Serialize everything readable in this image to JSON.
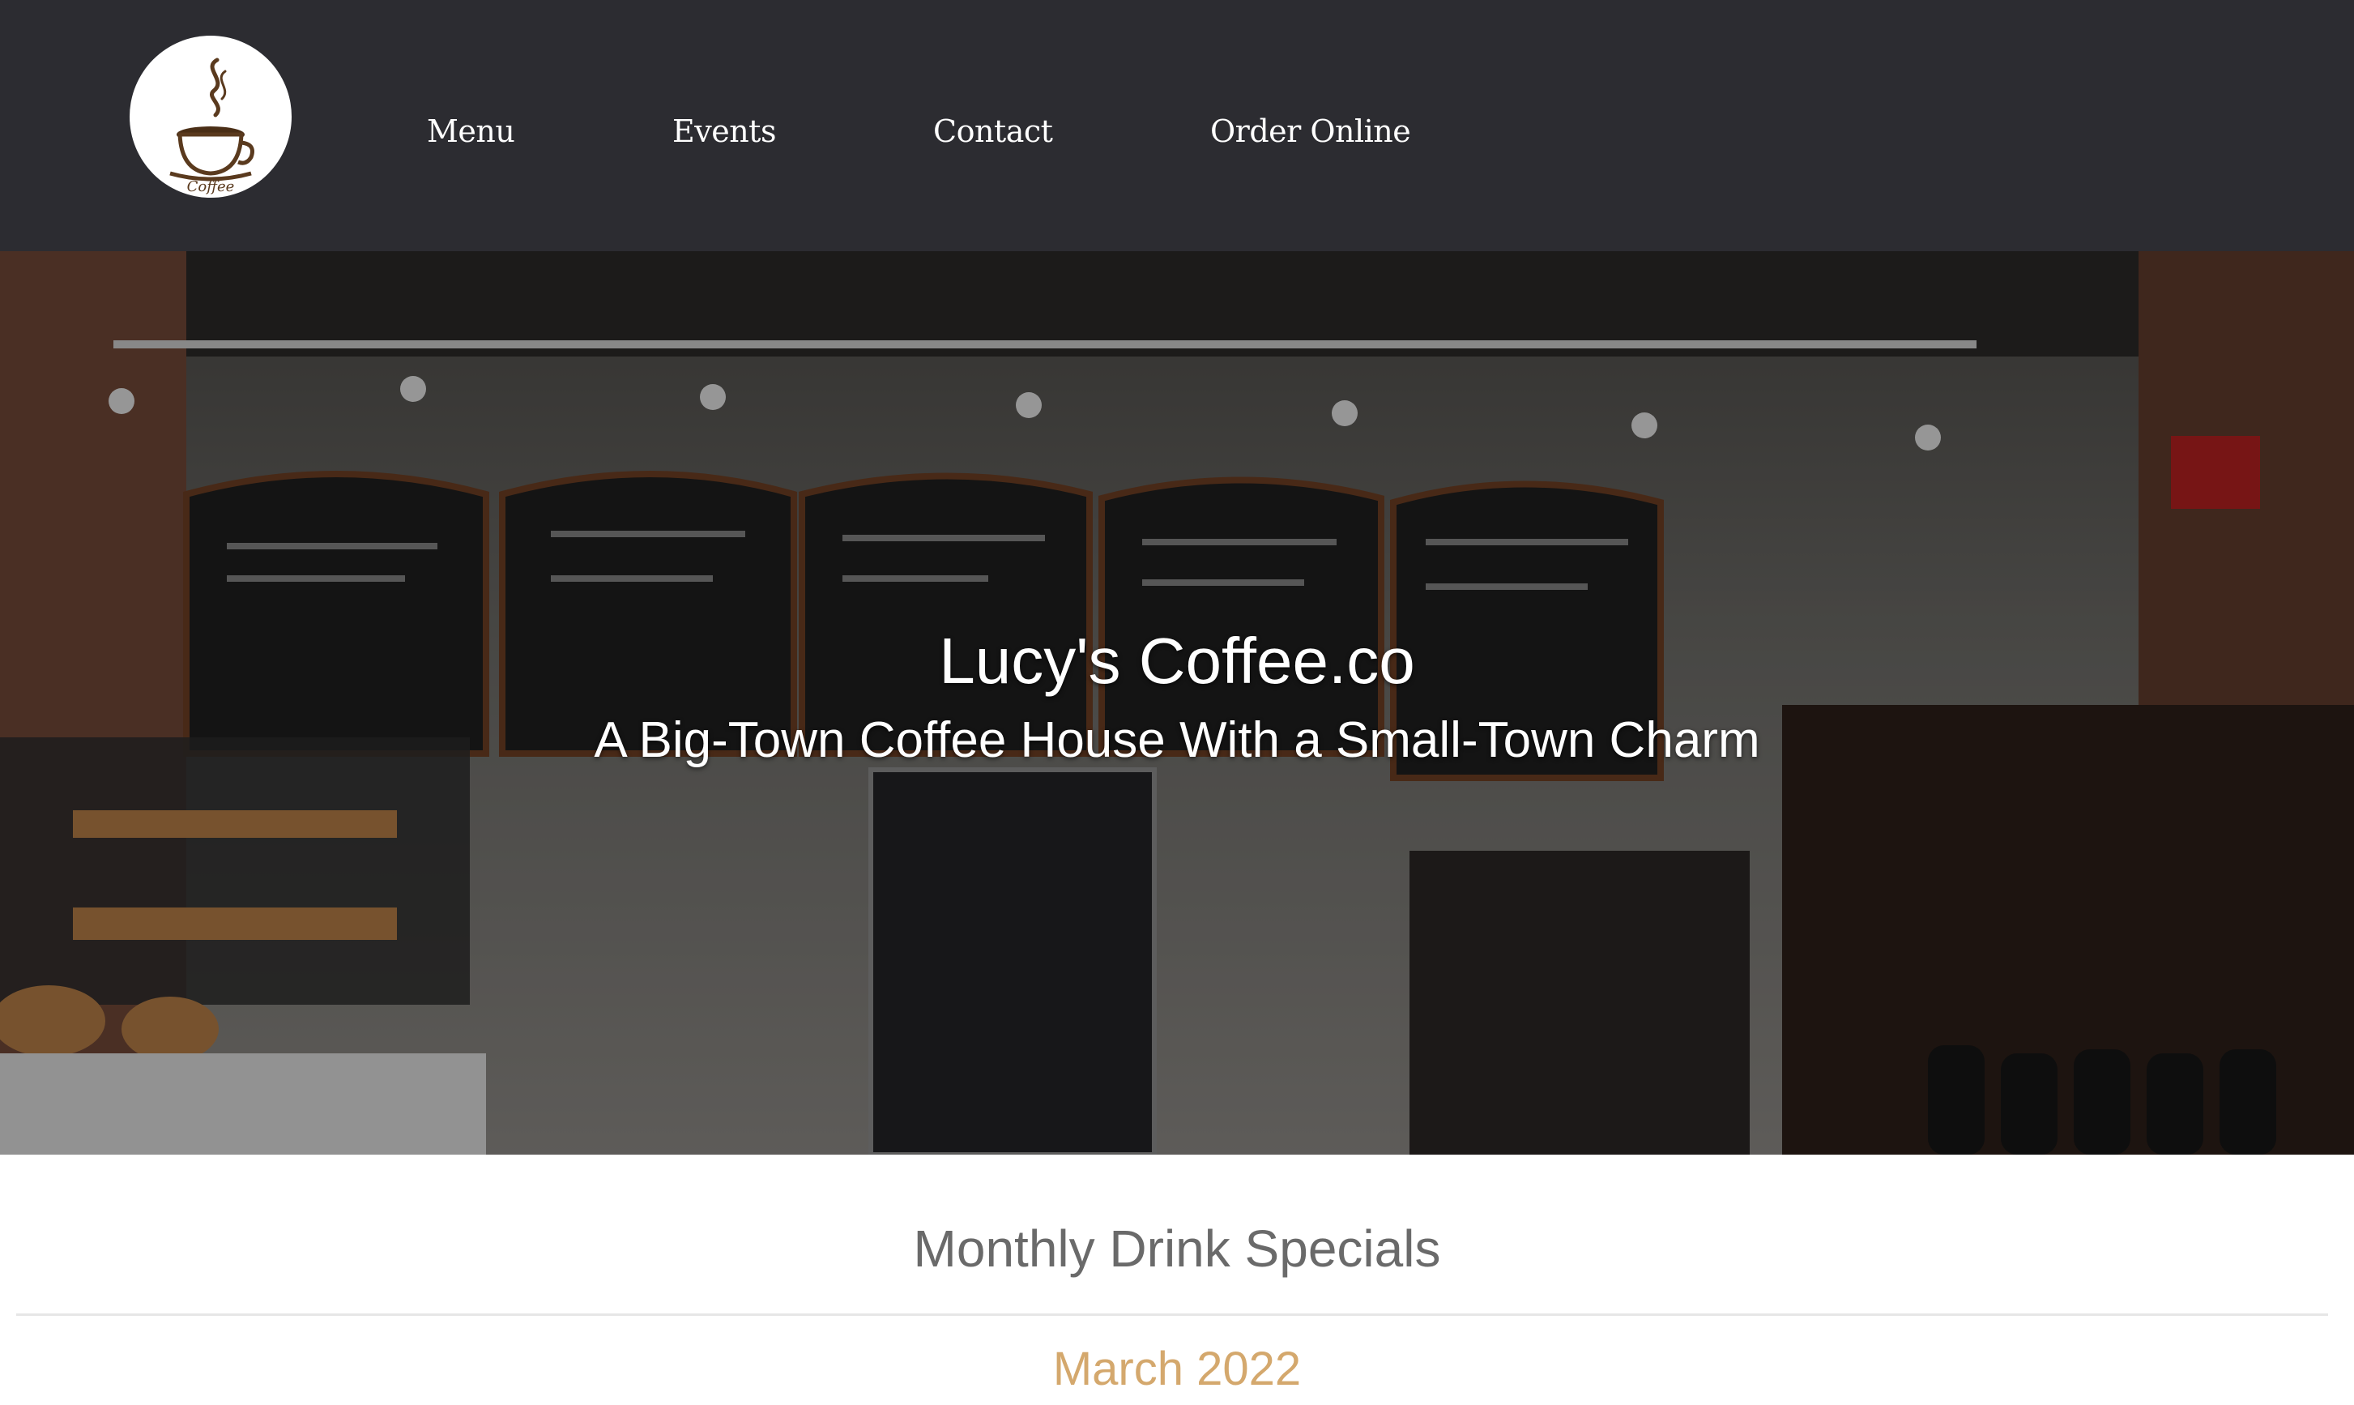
{
  "header": {
    "logo_icon": "coffee-cup-logo-icon",
    "logo_text": "Coffee",
    "nav": [
      {
        "label": "Menu"
      },
      {
        "label": "Events"
      },
      {
        "label": "Contact"
      },
      {
        "label": "Order Online"
      }
    ]
  },
  "hero": {
    "title": "Lucy's Coffee.co",
    "subtitle": "A Big-Town Coffee House With a Small-Town Charm",
    "background": "coffee-shop-interior-photo"
  },
  "specials": {
    "heading": "Monthly Drink Specials",
    "month": "March 2022"
  },
  "colors": {
    "navbar": "#2c2c31",
    "accent": "#d4a86d",
    "heading": "#6a6a6a"
  }
}
